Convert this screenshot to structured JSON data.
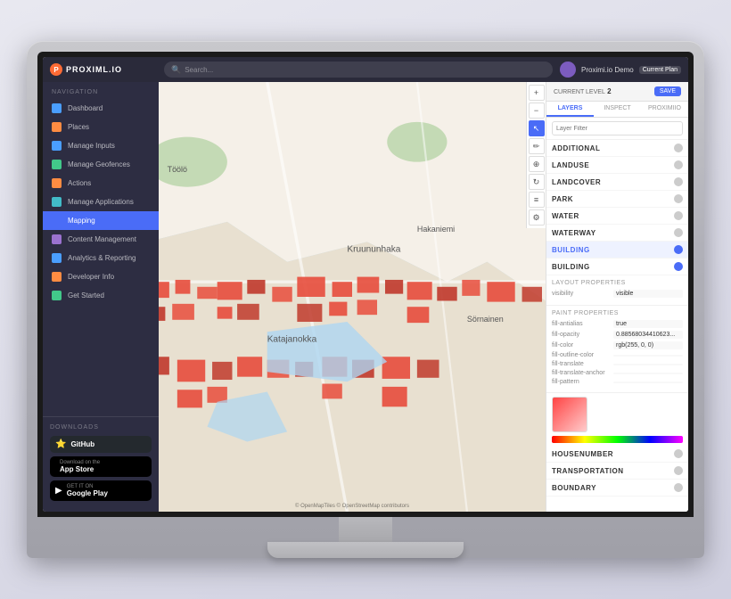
{
  "monitor": {
    "screen_bg": "#1a1a1a"
  },
  "topbar": {
    "logo_text": "PROXIML.IO",
    "search_placeholder": "Search...",
    "user_name": "Proximi.io Demo",
    "plan_badge": "Current Plan"
  },
  "sidebar": {
    "nav_title": "NAVIGATION",
    "items": [
      {
        "id": "dashboard",
        "label": "Dashboard",
        "icon": "blue"
      },
      {
        "id": "places",
        "label": "Places",
        "icon": "orange"
      },
      {
        "id": "manage-inputs",
        "label": "Manage Inputs",
        "icon": "blue"
      },
      {
        "id": "manage-geofences",
        "label": "Manage Geofences",
        "icon": "green"
      },
      {
        "id": "actions",
        "label": "Actions",
        "icon": "orange"
      },
      {
        "id": "manage-applications",
        "label": "Manage Applications",
        "icon": "teal"
      },
      {
        "id": "mapping",
        "label": "Mapping",
        "icon": "map-icon",
        "active": true
      },
      {
        "id": "content-management",
        "label": "Content Management",
        "icon": "purple"
      },
      {
        "id": "analytics-reporting",
        "label": "Analytics & Reporting",
        "icon": "blue"
      },
      {
        "id": "developer-info",
        "label": "Developer Info",
        "icon": "orange"
      },
      {
        "id": "get-started",
        "label": "Get Started",
        "icon": "green"
      }
    ],
    "downloads_title": "DOWNLOADS",
    "downloads": [
      {
        "id": "github",
        "sub": "",
        "name": "GitHub",
        "icon": "⭐"
      },
      {
        "id": "appstore",
        "sub": "Download on the",
        "name": "App Store",
        "icon": ""
      },
      {
        "id": "googleplay",
        "sub": "GET IT ON",
        "name": "Google Play",
        "icon": "▶"
      }
    ]
  },
  "map": {
    "attribution": "© OpenMapTiles © OpenStreetMap contributors"
  },
  "right_panel": {
    "level_label": "CURRENT LEVEL",
    "level_value": "2",
    "save_btn": "SAVE",
    "tabs": [
      "LAYERS",
      "INSPECT",
      "PROXIMIIO"
    ],
    "active_tab": "LAYERS",
    "filter_placeholder": "Layer Filter",
    "layers": [
      {
        "name": "ADDITIONAL",
        "visible": false
      },
      {
        "name": "LANDUSE",
        "visible": false
      },
      {
        "name": "LANDCOVER",
        "visible": false
      },
      {
        "name": "PARK",
        "visible": false
      },
      {
        "name": "WATER",
        "visible": false
      },
      {
        "name": "WATERWAY",
        "visible": false
      },
      {
        "name": "BUILDING",
        "visible": true
      },
      {
        "name": "BUILDING",
        "visible": true
      }
    ],
    "layout_properties_title": "LAYOUT PROPERTIES",
    "layout_props": [
      {
        "label": "visibility",
        "value": "visible"
      }
    ],
    "paint_properties_title": "PAINT PROPERTIES",
    "paint_props": [
      {
        "label": "fill-antialias",
        "value": "true"
      },
      {
        "label": "fill-opacity",
        "value": "0.885680344106235"
      },
      {
        "label": "fill-color",
        "value": "rgb(255, 0, 0)"
      },
      {
        "label": "fill-outline-color",
        "value": ""
      },
      {
        "label": "fill-translate",
        "value": ""
      },
      {
        "label": "fill-translate-anchor",
        "value": ""
      },
      {
        "label": "fill-pattern",
        "value": ""
      }
    ],
    "more_layers": [
      {
        "name": "HOUSENUMBER",
        "visible": false
      },
      {
        "name": "TRANSPORTATION",
        "visible": false
      },
      {
        "name": "BOUNDARY",
        "visible": false
      }
    ]
  }
}
